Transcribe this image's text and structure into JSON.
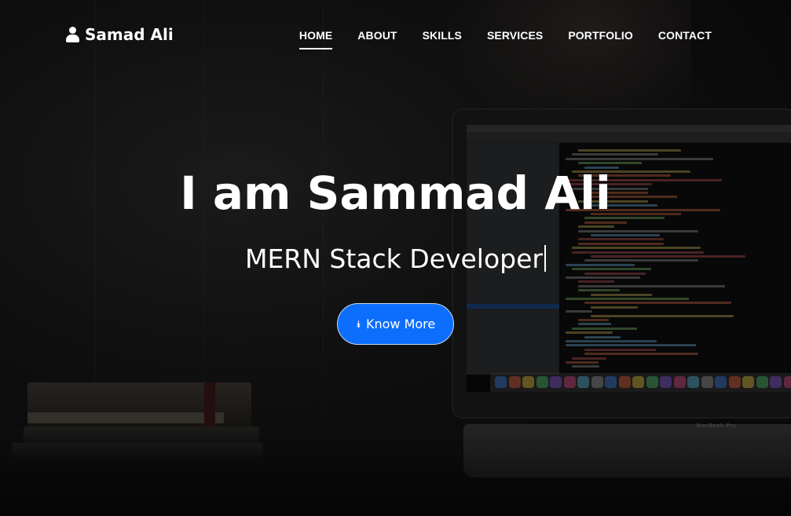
{
  "brand": {
    "name": "Samad Ali",
    "icon": "user-icon"
  },
  "nav": {
    "items": [
      {
        "label": "HOME",
        "active": true
      },
      {
        "label": "ABOUT",
        "active": false
      },
      {
        "label": "SKILLS",
        "active": false
      },
      {
        "label": "SERVICES",
        "active": false
      },
      {
        "label": "PORTFOLIO",
        "active": false
      },
      {
        "label": "CONTACT",
        "active": false
      }
    ]
  },
  "hero": {
    "headline": "I am Sammad Ali",
    "subtitle": "MERN Stack Developer",
    "cta_label": "Know More",
    "cta_icon": "double-chevron-down-icon",
    "background_label": "MacBook Pro"
  },
  "colors": {
    "accent": "#0d6efd",
    "text": "#ffffff"
  }
}
